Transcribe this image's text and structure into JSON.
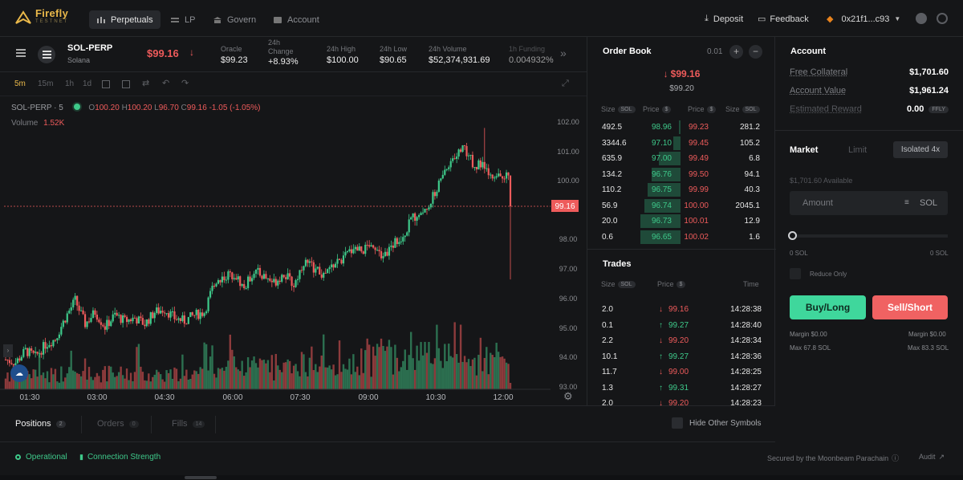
{
  "app": {
    "name": "Firefly",
    "subtitle": "TESTNET"
  },
  "nav": {
    "tabs": [
      "Perpetuals",
      "LP",
      "Govern",
      "Account"
    ],
    "active": "Perpetuals"
  },
  "topbar": {
    "deposit": "Deposit",
    "feedback": "Feedback",
    "wallet": "0x21f1...c93"
  },
  "market": {
    "symbol": "SOL-PERP",
    "name": "Solana",
    "price": "$99.16",
    "stats": [
      {
        "label": "Oracle",
        "value": "$99.23"
      },
      {
        "label": "24h Change",
        "value": "+8.93%"
      },
      {
        "label": "24h High",
        "value": "$100.00"
      },
      {
        "label": "24h Low",
        "value": "$90.65"
      },
      {
        "label": "24h Volume",
        "value": "$52,374,931.69"
      },
      {
        "label": "1h Funding",
        "value": "0.004932%"
      }
    ]
  },
  "chart_toolbar": {
    "timeframes": [
      "5m",
      "15m",
      "1h",
      "1d"
    ],
    "active": "5m"
  },
  "chart": {
    "legend_symbol": "SOL-PERP · 5",
    "o": "100.20",
    "h": "100.20",
    "l": "96.70",
    "c": "99.16",
    "change": "-1.05 (-1.05%)",
    "volume_label": "Volume",
    "volume_value": "1.52K",
    "last_price_tag": "99.16",
    "y_ticks": [
      "102.00",
      "101.00",
      "100.00",
      "98.00",
      "97.00",
      "96.00",
      "95.00",
      "94.00",
      "93.00"
    ],
    "x_ticks": [
      "01:30",
      "03:00",
      "04:30",
      "06:00",
      "07:30",
      "09:00",
      "10:30",
      "12:00"
    ]
  },
  "chart_data": {
    "type": "candlestick",
    "price_range": [
      93.0,
      102.0
    ],
    "anchors": [
      [
        0,
        94.0
      ],
      [
        5,
        93.9
      ],
      [
        10,
        94.3
      ],
      [
        15,
        94.1
      ],
      [
        20,
        94.5
      ],
      [
        25,
        94.7
      ],
      [
        30,
        95.4
      ],
      [
        35,
        96.0
      ],
      [
        40,
        95.2
      ],
      [
        45,
        95.6
      ],
      [
        50,
        95.1
      ],
      [
        55,
        95.5
      ],
      [
        60,
        95.3
      ],
      [
        65,
        95.4
      ],
      [
        70,
        95.2
      ],
      [
        75,
        95.6
      ],
      [
        80,
        95.7
      ],
      [
        85,
        95.4
      ],
      [
        90,
        95.3
      ],
      [
        95,
        95.5
      ],
      [
        100,
        95.6
      ],
      [
        105,
        96.6
      ],
      [
        110,
        96.8
      ],
      [
        115,
        96.9
      ],
      [
        120,
        96.4
      ],
      [
        125,
        97.0
      ],
      [
        130,
        96.8
      ],
      [
        135,
        96.6
      ],
      [
        140,
        96.9
      ],
      [
        145,
        96.5
      ],
      [
        150,
        97.3
      ],
      [
        155,
        97.1
      ],
      [
        160,
        96.8
      ],
      [
        165,
        97.2
      ],
      [
        170,
        97.4
      ],
      [
        175,
        97.8
      ],
      [
        180,
        97.7
      ],
      [
        185,
        97.9
      ],
      [
        190,
        97.5
      ],
      [
        195,
        97.9
      ],
      [
        200,
        98.2
      ],
      [
        205,
        98.8
      ],
      [
        210,
        99.0
      ],
      [
        215,
        99.5
      ],
      [
        220,
        100.2
      ],
      [
        225,
        100.8
      ],
      [
        230,
        101.2
      ],
      [
        235,
        100.6
      ],
      [
        240,
        100.5
      ],
      [
        245,
        100.0
      ],
      [
        250,
        100.2
      ],
      [
        253,
        100.2
      ],
      [
        254,
        99.16
      ]
    ]
  },
  "orderbook": {
    "title": "Order Book",
    "tick": "0.01",
    "last_price": "$99.16",
    "mark_price": "$99.20",
    "headers": {
      "size": "Size",
      "price": "Price",
      "unit": "SOL",
      "quote": "$"
    },
    "rows": [
      {
        "bid_size": "492.5",
        "bid_price": "98.96",
        "ask_price": "99.23",
        "ask_size": "281.2",
        "bid_depth": 0.02,
        "ask_depth": 0.0
      },
      {
        "bid_size": "3344.6",
        "bid_price": "97.10",
        "ask_price": "99.45",
        "ask_size": "105.2",
        "bid_depth": 0.1,
        "ask_depth": 0.0
      },
      {
        "bid_size": "635.9",
        "bid_price": "97.00",
        "ask_price": "99.49",
        "ask_size": "6.8",
        "bid_depth": 0.3,
        "ask_depth": 0.0
      },
      {
        "bid_size": "134.2",
        "bid_price": "96.76",
        "ask_price": "99.50",
        "ask_size": "94.1",
        "bid_depth": 0.4,
        "ask_depth": 0.0
      },
      {
        "bid_size": "110.2",
        "bid_price": "96.75",
        "ask_price": "99.99",
        "ask_size": "40.3",
        "bid_depth": 0.45,
        "ask_depth": 0.0
      },
      {
        "bid_size": "56.9",
        "bid_price": "96.74",
        "ask_price": "100.00",
        "ask_size": "2045.1",
        "bid_depth": 0.5,
        "ask_depth": 0.0
      },
      {
        "bid_size": "20.0",
        "bid_price": "96.73",
        "ask_price": "100.01",
        "ask_size": "12.9",
        "bid_depth": 0.55,
        "ask_depth": 0.0
      },
      {
        "bid_size": "0.6",
        "bid_price": "96.65",
        "ask_price": "100.02",
        "ask_size": "1.6",
        "bid_depth": 0.55,
        "ask_depth": 0.0
      }
    ]
  },
  "trades": {
    "title": "Trades",
    "headers": {
      "size": "Size",
      "unit": "SOL",
      "price": "Price",
      "quote": "$",
      "time": "Time"
    },
    "rows": [
      {
        "size": "2.0",
        "price": "99.16",
        "dir": "down",
        "time": "14:28:38"
      },
      {
        "size": "0.1",
        "price": "99.27",
        "dir": "up",
        "time": "14:28:40"
      },
      {
        "size": "2.2",
        "price": "99.20",
        "dir": "down",
        "time": "14:28:34"
      },
      {
        "size": "10.1",
        "price": "99.27",
        "dir": "up",
        "time": "14:28:36"
      },
      {
        "size": "11.7",
        "price": "99.00",
        "dir": "down",
        "time": "14:28:25"
      },
      {
        "size": "1.3",
        "price": "99.31",
        "dir": "up",
        "time": "14:28:27"
      },
      {
        "size": "2.0",
        "price": "99.20",
        "dir": "down",
        "time": "14:28:23"
      }
    ]
  },
  "account": {
    "title": "Account",
    "rows": [
      {
        "label": "Free Collateral",
        "value": "$1,701.60"
      },
      {
        "label": "Account Value",
        "value": "$1,961.24"
      },
      {
        "label": "Estimated Reward",
        "value": "0.00",
        "unit": "FFLY"
      }
    ]
  },
  "order_form": {
    "tabs": [
      "Market",
      "Limit"
    ],
    "active": "Market",
    "leverage": "Isolated 4x",
    "available": "$1,701.60 Available",
    "amount_placeholder": "Amount",
    "amount_unit": "SOL",
    "slider_min": "0 SOL",
    "slider_max": "0 SOL",
    "slider_value": 0,
    "reduce_only": "Reduce Only",
    "buy": "Buy/Long",
    "sell": "Sell/Short",
    "buy_margin": "Margin $0.00",
    "sell_margin": "Margin $0.00",
    "buy_max": "Max 67.8 SOL",
    "sell_max": "Max 83.3 SOL"
  },
  "positions": {
    "tabs": [
      {
        "label": "Positions",
        "count": "2"
      },
      {
        "label": "Orders",
        "count": "0"
      },
      {
        "label": "Fills",
        "count": "14"
      }
    ],
    "hide_other": "Hide Other Symbols"
  },
  "footer": {
    "status": "Operational",
    "connection": "Connection Strength",
    "secured": "Secured by the Moonbeam Parachain",
    "audit": "Audit"
  },
  "colors": {
    "green": "#3ec98a",
    "red": "#ee5b5b",
    "accent": "#e9b84a"
  }
}
